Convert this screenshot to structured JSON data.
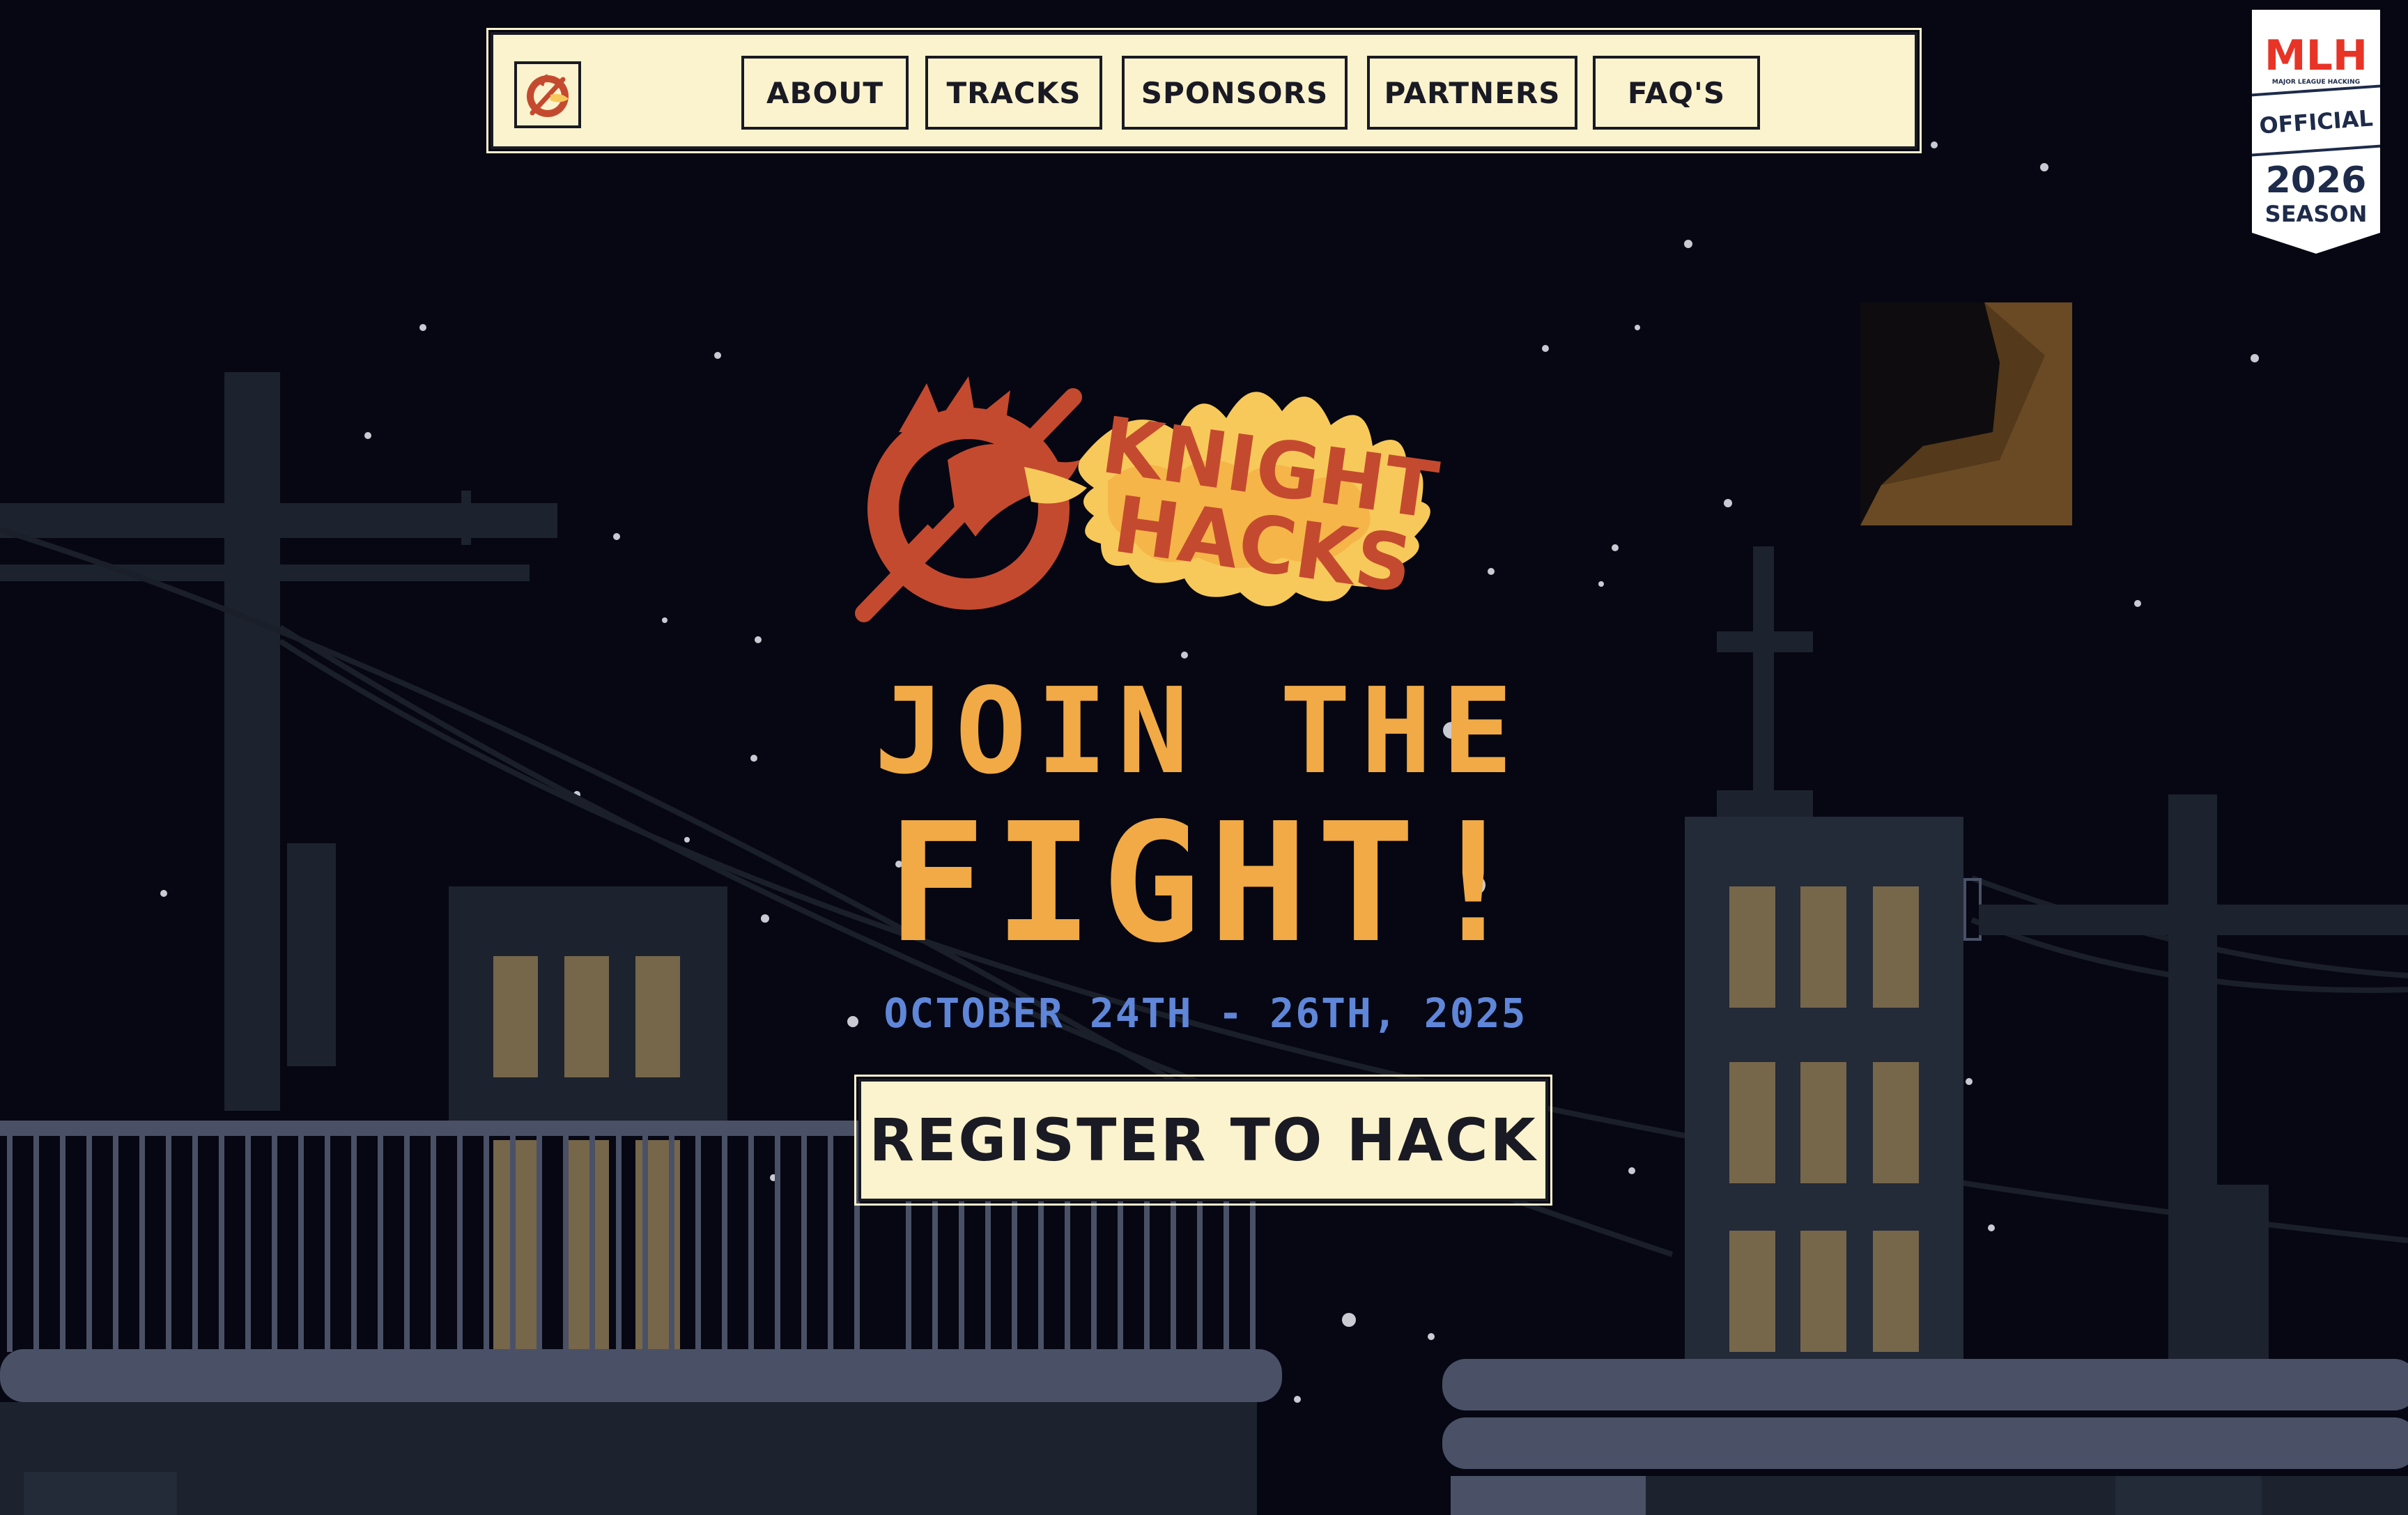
{
  "nav": {
    "items": [
      {
        "label": "ABOUT"
      },
      {
        "label": "TRACKS"
      },
      {
        "label": "SPONSORS"
      },
      {
        "label": "PARTNERS"
      },
      {
        "label": "FAQ'S"
      }
    ]
  },
  "badge": {
    "brand": "MLH",
    "sub": "MAJOR LEAGUE HACKING",
    "official": "OFFICIAL",
    "year": "2026",
    "season": "SEASON"
  },
  "hero": {
    "logo_line1": "KNIGHT",
    "logo_line2": "HACKS",
    "headline_1": "JOIN THE",
    "headline_2": "FIGHT!",
    "dates": "OCTOBER 24TH - 26TH, 2025",
    "cta": "REGISTER TO HACK"
  },
  "colors": {
    "background": "#060713",
    "accent_orange": "#f1aa45",
    "date_blue": "#5f86d8",
    "cream": "#fbf3cd",
    "logo_red": "#c44a2f",
    "flame_yellow": "#f7c95a",
    "building": "#1c222e",
    "window": "#76664a",
    "rooftop": "#4a5166"
  },
  "icons": {
    "nav_logo": "knight-hacks-emblem-icon",
    "moon": "moon-icon",
    "mlh": "mlh-badge"
  }
}
